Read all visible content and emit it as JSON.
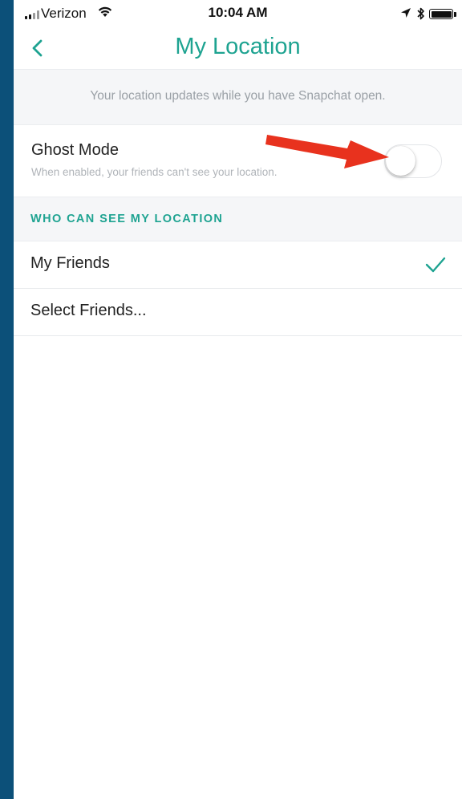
{
  "status_bar": {
    "carrier": "Verizon",
    "time": "10:04 AM",
    "icons": [
      "signal-bars-icon",
      "wifi-icon",
      "location-arrow-icon",
      "bluetooth-icon",
      "battery-icon"
    ]
  },
  "nav": {
    "title": "My Location",
    "back_icon": "chevron-left-icon"
  },
  "info_banner": {
    "text": "Your location updates while you have Snapchat open."
  },
  "ghost_mode": {
    "title": "Ghost Mode",
    "subtitle": "When enabled, your friends can't see your location.",
    "enabled": false
  },
  "section": {
    "title": "WHO CAN SEE MY LOCATION"
  },
  "options": [
    {
      "label": "My Friends",
      "selected": true
    },
    {
      "label": "Select Friends...",
      "selected": false
    }
  ],
  "colors": {
    "accent": "#1ea391",
    "annotation_arrow": "#e8321e",
    "background_frame": "#0c5079"
  }
}
